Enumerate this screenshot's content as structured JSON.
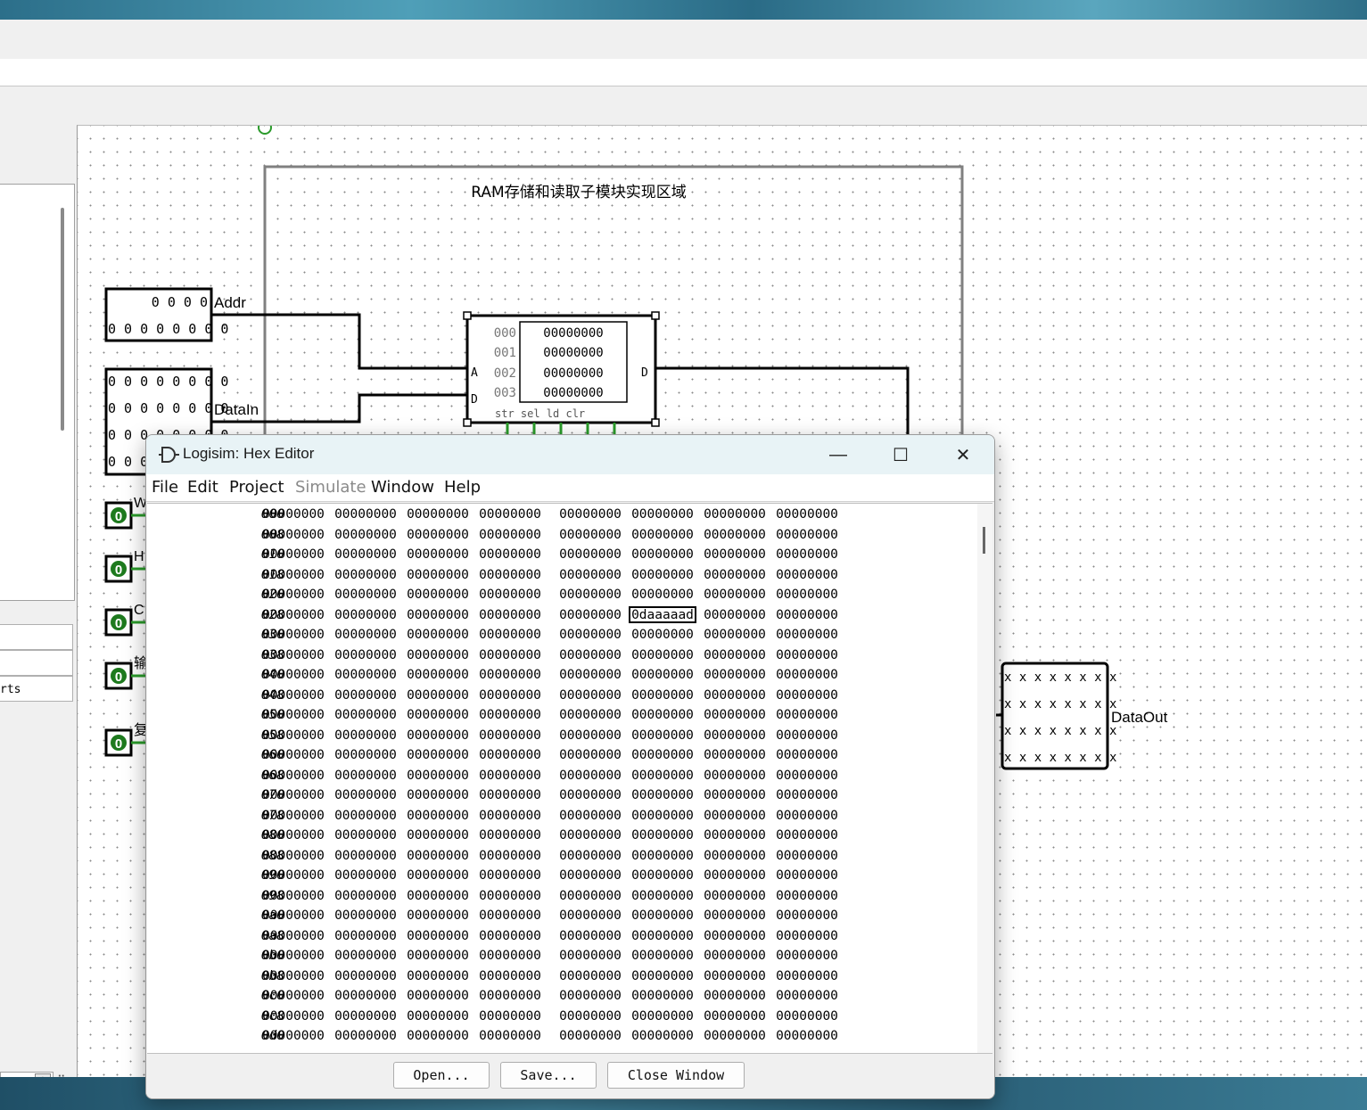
{
  "circuit": {
    "region_label": "RAM存储和读取子模块实现区域",
    "addr_probe": {
      "row1": "0 0 0 0",
      "row2": "0 0 0 0 0 0 0 0",
      "label": "Addr"
    },
    "datain_probe": {
      "rows": [
        "0 0 0 0 0 0 0 0",
        "0 0 0 0 0 0 0 0",
        "0 0 0 0 0 0 0 0",
        "0 0 0"
      ],
      "label": "DataIn"
    },
    "ram": {
      "addresses": [
        "000",
        "001",
        "002",
        "003"
      ],
      "values": [
        "00000000",
        "00000000",
        "00000000",
        "00000000"
      ],
      "pin_a": "A",
      "pin_d_in": "D",
      "pin_d_out": "D",
      "bottom_pins": "str sel  ld clr"
    },
    "switch_value": "0",
    "switch_labels": [
      "W",
      "H",
      "C",
      "输",
      "复"
    ],
    "dataout_probe": {
      "rows": [
        "x x x x x x x x",
        "x x x x x x x x",
        "x x x x x x x x",
        "x x x x x x x x"
      ],
      "label": "DataOut"
    }
  },
  "left_panel": {
    "attr_text": "rts"
  },
  "hex_editor": {
    "title": "Logisim: Hex Editor",
    "menu": [
      {
        "label": "File",
        "enabled": true
      },
      {
        "label": "Edit",
        "enabled": true
      },
      {
        "label": "Project",
        "enabled": true
      },
      {
        "label": "Simulate",
        "enabled": false
      },
      {
        "label": "Window",
        "enabled": true
      },
      {
        "label": "Help",
        "enabled": true
      }
    ],
    "default_word": "00000000",
    "selected": {
      "row": "028",
      "column": 5,
      "value": "0daaaaad"
    },
    "rows": [
      "000",
      "008",
      "010",
      "018",
      "020",
      "028",
      "030",
      "038",
      "040",
      "048",
      "050",
      "058",
      "060",
      "068",
      "070",
      "078",
      "080",
      "088",
      "090",
      "098",
      "0a0",
      "0a8",
      "0b0",
      "0b8",
      "0c0",
      "0c8",
      "0d0"
    ],
    "buttons": {
      "open": "Open...",
      "save": "Save...",
      "close": "Close Window"
    },
    "controls": {
      "minimize": "—",
      "maximize": "☐",
      "close": "✕"
    }
  },
  "colors": {
    "wire_green": "#2a9a2a",
    "wire_black": "#000000",
    "title_bar": "#e8f3f6",
    "region_border": "#808080"
  }
}
